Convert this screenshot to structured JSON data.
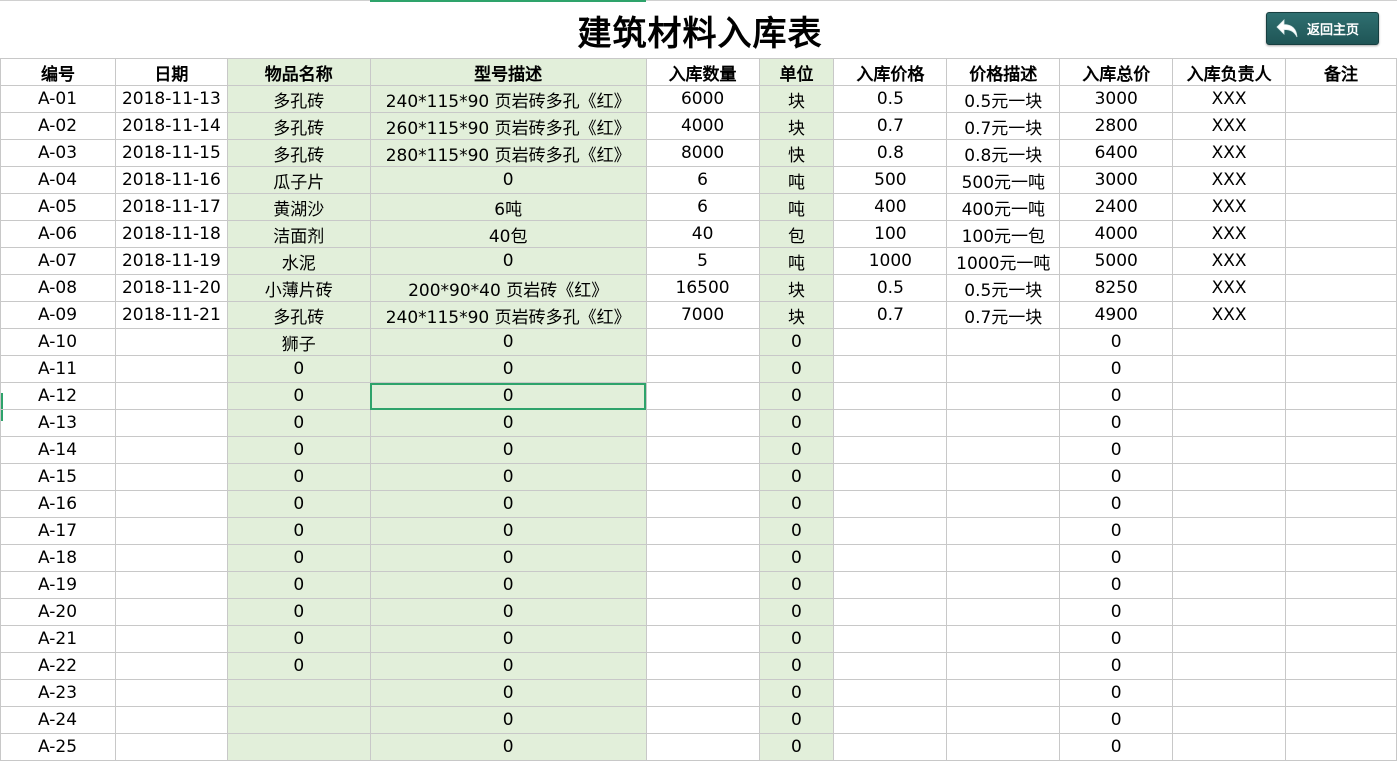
{
  "title": "建筑材料入库表",
  "back_button": {
    "label": "返回主页",
    "icon": "undo-arrow-icon"
  },
  "colors": {
    "accent_green": "#2ea36b",
    "highlight_green": "#e2efda",
    "button_teal": "#1f5556"
  },
  "headers": [
    "编号",
    "日期",
    "物品名称",
    "型号描述",
    "入库数量",
    "单位",
    "入库价格",
    "价格描述",
    "入库总价",
    "入库负责人",
    "备注"
  ],
  "rows": [
    [
      "A-01",
      "2018-11-13",
      "多孔砖",
      "240*115*90 页岩砖多孔《红》",
      "6000",
      "块",
      "0.5",
      "0.5元一块",
      "3000",
      "XXX",
      ""
    ],
    [
      "A-02",
      "2018-11-14",
      "多孔砖",
      "260*115*90 页岩砖多孔《红》",
      "4000",
      "块",
      "0.7",
      "0.7元一块",
      "2800",
      "XXX",
      ""
    ],
    [
      "A-03",
      "2018-11-15",
      "多孔砖",
      "280*115*90 页岩砖多孔《红》",
      "8000",
      "快",
      "0.8",
      "0.8元一块",
      "6400",
      "XXX",
      ""
    ],
    [
      "A-04",
      "2018-11-16",
      "瓜子片",
      "0",
      "6",
      "吨",
      "500",
      "500元一吨",
      "3000",
      "XXX",
      ""
    ],
    [
      "A-05",
      "2018-11-17",
      "黄湖沙",
      "6吨",
      "6",
      "吨",
      "400",
      "400元一吨",
      "2400",
      "XXX",
      ""
    ],
    [
      "A-06",
      "2018-11-18",
      "洁面剂",
      "40包",
      "40",
      "包",
      "100",
      "100元一包",
      "4000",
      "XXX",
      ""
    ],
    [
      "A-07",
      "2018-11-19",
      "水泥",
      "0",
      "5",
      "吨",
      "1000",
      "1000元一吨",
      "5000",
      "XXX",
      ""
    ],
    [
      "A-08",
      "2018-11-20",
      "小薄片砖",
      "200*90*40 页岩砖《红》",
      "16500",
      "块",
      "0.5",
      "0.5元一块",
      "8250",
      "XXX",
      ""
    ],
    [
      "A-09",
      "2018-11-21",
      "多孔砖",
      "240*115*90 页岩砖多孔《红》",
      "7000",
      "块",
      "0.7",
      "0.7元一块",
      "4900",
      "XXX",
      ""
    ],
    [
      "A-10",
      "",
      "狮子",
      "0",
      "",
      "0",
      "",
      "",
      "0",
      "",
      ""
    ],
    [
      "A-11",
      "",
      "0",
      "0",
      "",
      "0",
      "",
      "",
      "0",
      "",
      ""
    ],
    [
      "A-12",
      "",
      "0",
      "0",
      "",
      "0",
      "",
      "",
      "0",
      "",
      ""
    ],
    [
      "A-13",
      "",
      "0",
      "0",
      "",
      "0",
      "",
      "",
      "0",
      "",
      ""
    ],
    [
      "A-14",
      "",
      "0",
      "0",
      "",
      "0",
      "",
      "",
      "0",
      "",
      ""
    ],
    [
      "A-15",
      "",
      "0",
      "0",
      "",
      "0",
      "",
      "",
      "0",
      "",
      ""
    ],
    [
      "A-16",
      "",
      "0",
      "0",
      "",
      "0",
      "",
      "",
      "0",
      "",
      ""
    ],
    [
      "A-17",
      "",
      "0",
      "0",
      "",
      "0",
      "",
      "",
      "0",
      "",
      ""
    ],
    [
      "A-18",
      "",
      "0",
      "0",
      "",
      "0",
      "",
      "",
      "0",
      "",
      ""
    ],
    [
      "A-19",
      "",
      "0",
      "0",
      "",
      "0",
      "",
      "",
      "0",
      "",
      ""
    ],
    [
      "A-20",
      "",
      "0",
      "0",
      "",
      "0",
      "",
      "",
      "0",
      "",
      ""
    ],
    [
      "A-21",
      "",
      "0",
      "0",
      "",
      "0",
      "",
      "",
      "0",
      "",
      ""
    ],
    [
      "A-22",
      "",
      "0",
      "0",
      "",
      "0",
      "",
      "",
      "0",
      "",
      ""
    ],
    [
      "A-23",
      "",
      "",
      "0",
      "",
      "0",
      "",
      "",
      "0",
      "",
      ""
    ],
    [
      "A-24",
      "",
      "",
      "0",
      "",
      "0",
      "",
      "",
      "0",
      "",
      ""
    ],
    [
      "A-25",
      "",
      "",
      "0",
      "",
      "0",
      "",
      "",
      "0",
      "",
      ""
    ]
  ],
  "selected_cell": {
    "row": "A-12",
    "column": "型号描述"
  }
}
